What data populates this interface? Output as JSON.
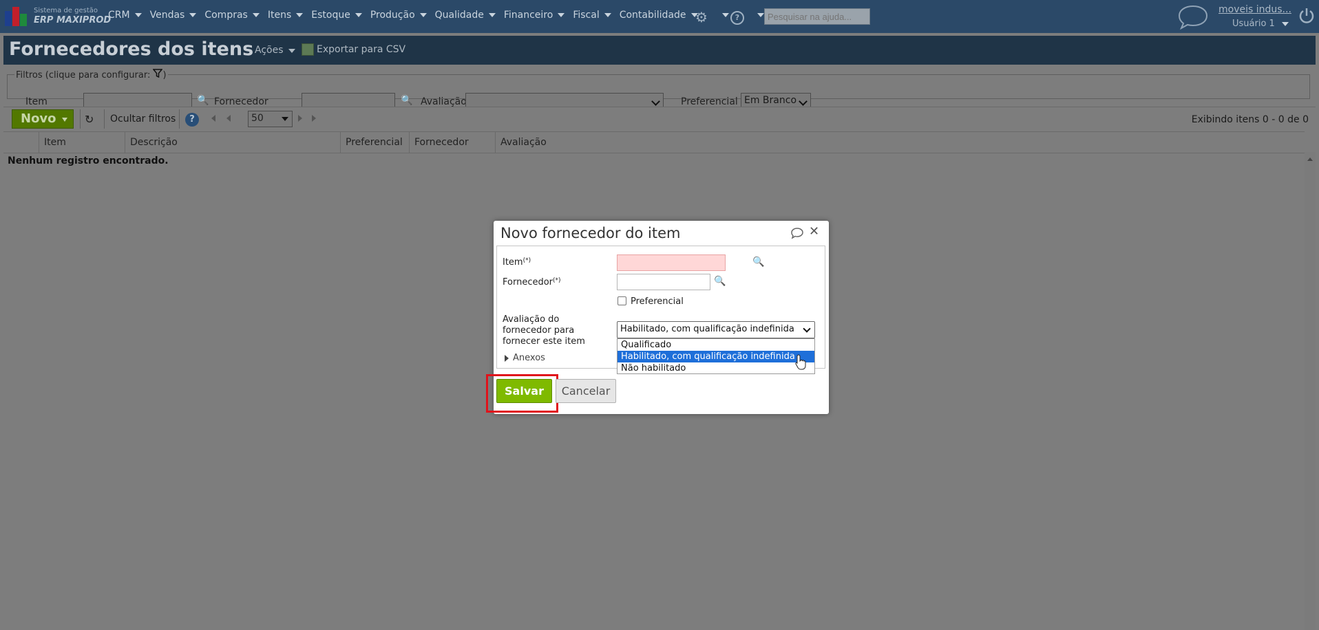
{
  "app": {
    "logo_line1": "Sistema de gestão",
    "logo_line2": "ERP MAXIPROD",
    "menu": [
      "CRM",
      "Vendas",
      "Compras",
      "Itens",
      "Estoque",
      "Produção",
      "Qualidade",
      "Financeiro",
      "Fiscal",
      "Contabilidade"
    ],
    "help_search_placeholder": "Pesquisar na ajuda...",
    "company": "moveis indus...",
    "user": "Usuário 1"
  },
  "page": {
    "title": "Fornecedores dos itens",
    "acoes": "Ações",
    "export_csv": "Exportar para CSV"
  },
  "filters": {
    "legend": "Filtros (clique para configurar:",
    "legend_close": ")",
    "item_label": "Item",
    "fornecedor_label": "Fornecedor",
    "avaliacao_label": "Avaliação",
    "preferencial_label": "Preferencial",
    "preferencial_value": "Em Branco"
  },
  "toolbar": {
    "novo": "Novo",
    "ocultar": "Ocultar filtros",
    "page_size": "50",
    "status": "Exibindo itens 0 - 0 de 0"
  },
  "grid": {
    "columns": [
      "Item",
      "Descrição",
      "Preferencial",
      "Fornecedor",
      "Avaliação"
    ],
    "empty": "Nenhum registro encontrado."
  },
  "dialog": {
    "title": "Novo fornecedor do item",
    "item_label": "Item",
    "fornecedor_label": "Fornecedor",
    "required_mark": "(*)",
    "preferencial": "Preferencial",
    "avaliacao_line1": "Avaliação do",
    "avaliacao_line2": "fornecedor para",
    "avaliacao_line3": "fornecer este item",
    "avaliacao_value": "Habilitado, com qualificação indefinida",
    "options": [
      "Qualificado",
      "Habilitado, com qualificação indefinida",
      "Não habilitado"
    ],
    "selected_option_index": 1,
    "anexos": "Anexos",
    "salvar": "Salvar",
    "cancelar": "Cancelar"
  },
  "colors": {
    "topbar": "#2b4968",
    "salvar": "#7fba00",
    "highlight": "#e0131b",
    "option_selected": "#1e6fd9"
  }
}
